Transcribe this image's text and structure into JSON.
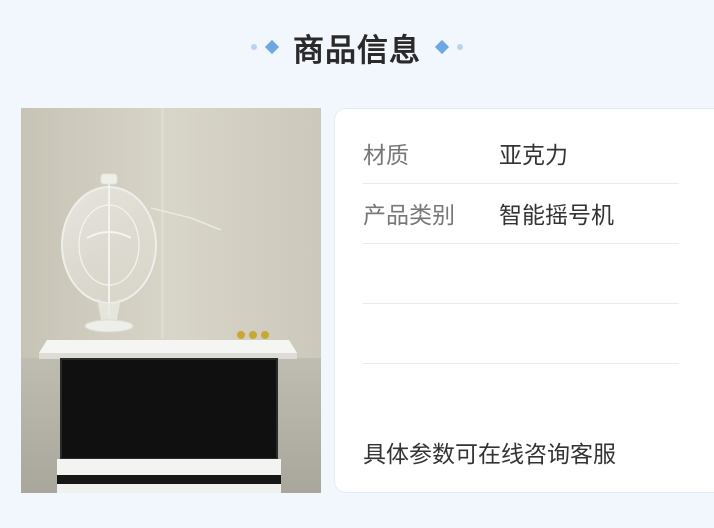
{
  "header": {
    "title": "商品信息"
  },
  "product_image": {
    "icon": "lottery-machine-photo"
  },
  "info": {
    "rows": [
      {
        "label": "材质",
        "value": "亚克力"
      },
      {
        "label": "产品类别",
        "value": "智能摇号机"
      },
      {
        "label": "",
        "value": ""
      },
      {
        "label": "",
        "value": ""
      }
    ],
    "note": "具体参数可在线咨询客服"
  },
  "colors": {
    "background": "#f2f7fd",
    "accent": "#6ea8e3"
  }
}
